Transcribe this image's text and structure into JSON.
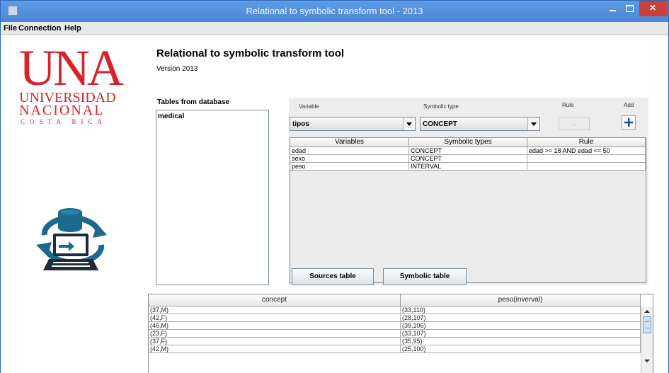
{
  "window": {
    "title": "Relational to symbolic transform tool - 2013"
  },
  "menu": [
    "File",
    "Connection",
    "Help"
  ],
  "logo": {
    "una": "UNA",
    "universidad": "UNIVERSIDAD",
    "nacional": "NACIONAL",
    "costa_rica": "COSTA RICA"
  },
  "app": {
    "title": "Relational to symbolic transform tool",
    "version": "Version 2013"
  },
  "tables": {
    "label": "Tables from database",
    "items": [
      "medical"
    ]
  },
  "form": {
    "variable_label": "Variable",
    "symbolic_type_label": "Symbolic type",
    "rule_label": "Rule",
    "add_label": "Add",
    "variable_value": "tipos",
    "symbolic_type_value": "CONCEPT",
    "rule_button": "..."
  },
  "variables_table": {
    "headers": [
      "Variables",
      "Symbolic types",
      "Rule"
    ],
    "rows": [
      [
        "edad",
        "CONCEPT",
        "edad >= 18  AND  edad <= 50"
      ],
      [
        "sexo",
        "CONCEPT",
        ""
      ],
      [
        "peso",
        "INTERVAL",
        ""
      ]
    ]
  },
  "buttons": {
    "sources": "Sources table",
    "symbolic": "Symbolic table"
  },
  "result_table": {
    "headers": [
      "concept",
      "peso(inverval)"
    ],
    "rows": [
      [
        "(37,M)",
        "(33,110)"
      ],
      [
        "(42,F)",
        "(28,107)"
      ],
      [
        "(46,M)",
        "(39,106)"
      ],
      [
        "(23,F)",
        "(33,107)"
      ],
      [
        "(37,F)",
        "(35,95)"
      ],
      [
        "(42,M)",
        "(25,100)"
      ]
    ]
  },
  "colors": {
    "titlebar": "#4a86d4",
    "logo_red": "#d8232a",
    "icon_blue": "#1d6a8e",
    "icon_dark": "#1f2d3a"
  }
}
